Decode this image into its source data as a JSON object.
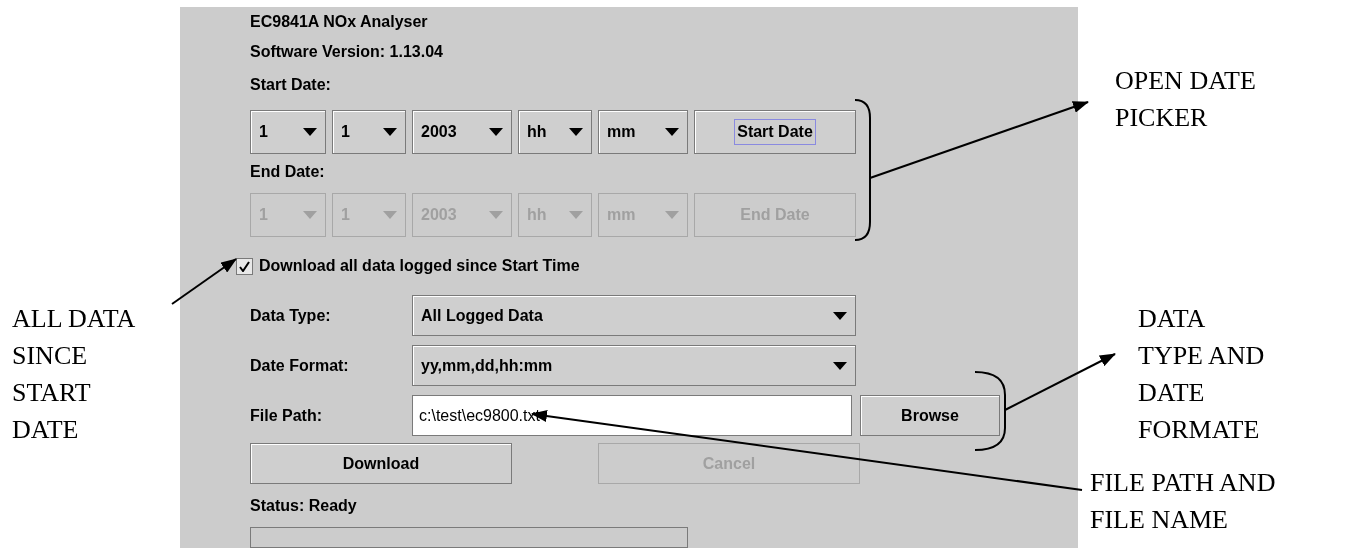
{
  "header": {
    "title": "EC9841A NOx Analyser",
    "version": "Software Version: 1.13.04"
  },
  "date_rows": [
    {
      "label": "Start Date:",
      "disabled": false,
      "fields": [
        {
          "value": "1"
        },
        {
          "value": "1"
        },
        {
          "value": "2003"
        },
        {
          "value": "hh"
        },
        {
          "value": "mm"
        }
      ],
      "button": {
        "label": "Start Date",
        "focused": true
      }
    },
    {
      "label": "End Date:",
      "disabled": true,
      "fields": [
        {
          "value": "1"
        },
        {
          "value": "1"
        },
        {
          "value": "2003"
        },
        {
          "value": "hh"
        },
        {
          "value": "mm"
        }
      ],
      "button": {
        "label": "End Date",
        "focused": false
      }
    }
  ],
  "checkbox": {
    "label": "Download all data logged since Start Time",
    "checked": true
  },
  "form_rows": [
    {
      "kind": "select",
      "label": "Data Type:",
      "value": "All Logged Data"
    },
    {
      "kind": "select",
      "label": "Date Format:",
      "value": "yy,mm,dd,hh:mm"
    },
    {
      "kind": "text",
      "label": "File Path:",
      "value": "c:\\test\\ec9800.txt",
      "button": "Browse"
    }
  ],
  "actions": [
    {
      "label": "Download",
      "disabled": false
    },
    {
      "label": "Cancel",
      "disabled": true
    }
  ],
  "status": {
    "text": "Status: Ready",
    "level": 0
  },
  "annotations": [
    {
      "text": "OPEN DATE\nPICKER"
    },
    {
      "text": "ALL DATA\nSINCE\nSTART\nDATE"
    },
    {
      "text": "DATA\nTYPE AND\nDATE\nFORMATE"
    },
    {
      "text": "FILE PATH AND\nFILE NAME"
    }
  ]
}
